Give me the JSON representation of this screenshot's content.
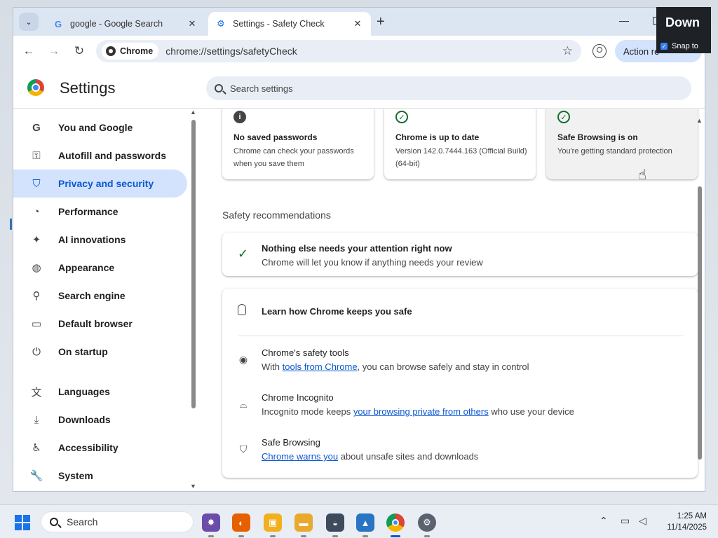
{
  "browser": {
    "tabs": [
      {
        "title": "google - Google Search",
        "favicon": "google-g-icon",
        "active": false
      },
      {
        "title": "Settings - Safety Check",
        "favicon": "settings-gear-icon",
        "active": true
      }
    ],
    "chip": "Chrome",
    "url": "chrome://settings/safetyCheck",
    "action_button": "Action re"
  },
  "overlay": {
    "title": "Down",
    "option": "Snap to"
  },
  "settings": {
    "title": "Settings",
    "search_placeholder": "Search settings"
  },
  "sidebar": {
    "items": [
      {
        "label": "You and Google",
        "icon": "google-g-icon"
      },
      {
        "label": "Autofill and passwords",
        "icon": "key-icon"
      },
      {
        "label": "Privacy and security",
        "icon": "shield-icon",
        "active": true
      },
      {
        "label": "Performance",
        "icon": "speedometer-icon"
      },
      {
        "label": "AI innovations",
        "icon": "sparkle-icon"
      },
      {
        "label": "Appearance",
        "icon": "palette-icon"
      },
      {
        "label": "Search engine",
        "icon": "search-icon"
      },
      {
        "label": "Default browser",
        "icon": "browser-window-icon"
      },
      {
        "label": "On startup",
        "icon": "power-icon"
      },
      {
        "label": "Languages",
        "icon": "translate-icon"
      },
      {
        "label": "Downloads",
        "icon": "download-icon"
      },
      {
        "label": "Accessibility",
        "icon": "accessibility-icon"
      },
      {
        "label": "System",
        "icon": "wrench-icon"
      }
    ]
  },
  "safety_check": {
    "cards": [
      {
        "title": "No saved passwords",
        "desc": "Chrome can check your passwords when you save them",
        "icon": "info-icon"
      },
      {
        "title": "Chrome is up to date",
        "desc": "Version 142.0.7444.163 (Official Build) (64-bit)",
        "icon": "check-circle-icon"
      },
      {
        "title": "Safe Browsing is on",
        "desc": "You're getting standard protection",
        "icon": "check-circle-icon"
      }
    ],
    "section_label": "Safety recommendations",
    "recommendation": {
      "title": "Nothing else needs your attention right now",
      "desc": "Chrome will let you know if anything needs your review"
    },
    "learn": {
      "heading": "Learn how Chrome keeps you safe",
      "rows": [
        {
          "title": "Chrome's safety tools",
          "pre": "With ",
          "link": "tools from Chrome",
          "post": ", you can browse safely and stay in control",
          "icon": "chrome-icon"
        },
        {
          "title": "Chrome Incognito",
          "pre": "Incognito mode keeps ",
          "link": "your browsing private from others",
          "post": " who use your device",
          "icon": "incognito-icon"
        },
        {
          "title": "Safe Browsing",
          "pre": "",
          "link": "Chrome warns you",
          "post": " about unsafe sites and downloads",
          "icon": "shield-icon"
        }
      ]
    }
  },
  "taskbar": {
    "search_label": "Search",
    "time": "1:25 AM",
    "date": "11/14/2025"
  },
  "colors": {
    "accent": "#0b57d0",
    "active_bg": "#d3e3fd",
    "ok_green": "#146c2e"
  }
}
